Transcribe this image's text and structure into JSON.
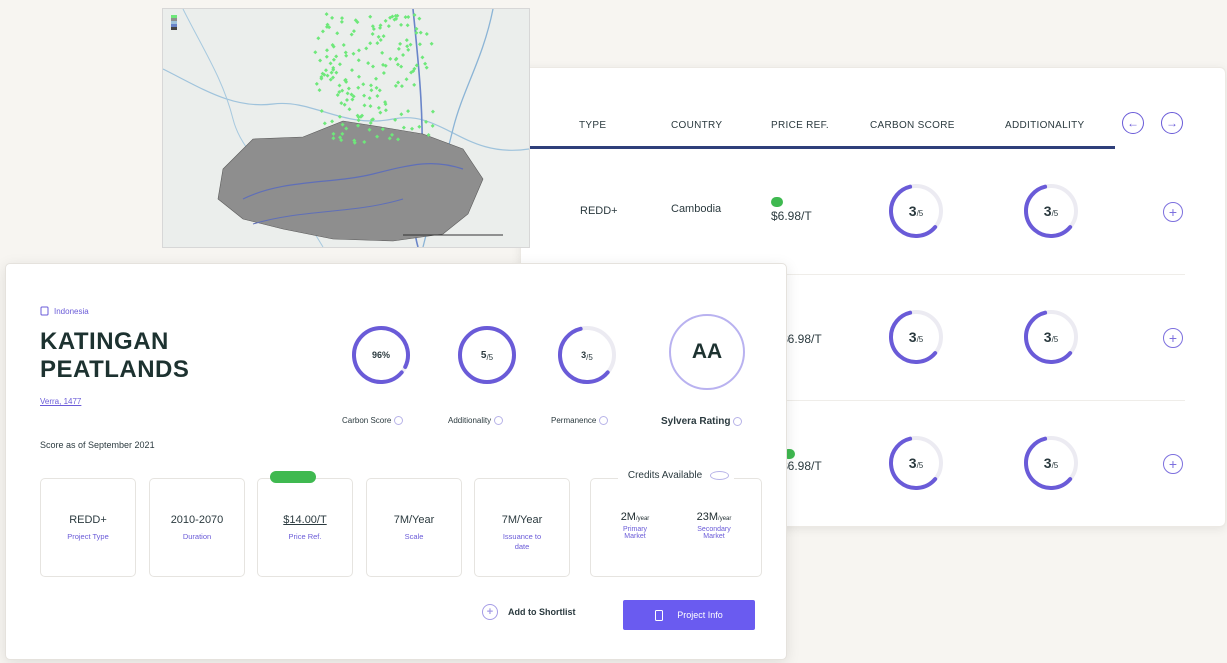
{
  "table": {
    "columns": [
      "TYPE",
      "COUNTRY",
      "PRICE REF.",
      "CARBON SCORE",
      "ADDITIONALITY"
    ],
    "nav_prev": "←",
    "nav_next": "→",
    "rows": [
      {
        "type": "REDD+",
        "country": "Cambodia",
        "price_badge": "",
        "price": "$6.98/T",
        "carbon_score": "3",
        "additionality": "3",
        "score_unit": "/5",
        "add": "+"
      },
      {
        "type": "",
        "country": "",
        "price_badge": "",
        "price": "$6.98/T",
        "carbon_score": "3",
        "additionality": "3",
        "score_unit": "/5",
        "add": "+"
      },
      {
        "type": "",
        "country": "",
        "price_badge": "",
        "price": "$6.98/T",
        "carbon_score": "3",
        "additionality": "3",
        "score_unit": "/5",
        "add": "+"
      }
    ]
  },
  "map": {
    "legend": [
      "",
      "",
      "",
      "",
      ""
    ]
  },
  "detail": {
    "country": "Indonesia",
    "title_line1": "KATINGAN",
    "title_line2": "PEATLANDS",
    "link": "Verra, 1477",
    "score_date": "Score as of September 2021",
    "metrics": {
      "carbon_score": {
        "value": "96%",
        "label": "Carbon Score",
        "fraction": 0.96
      },
      "additionality": {
        "value": "5",
        "unit": "/5",
        "label": "Additionality",
        "fraction": 1.0
      },
      "permanence": {
        "value": "3",
        "unit": "/5",
        "label": "Permanence",
        "fraction": 0.6
      },
      "rating": {
        "value": "AA",
        "label": "Sylvera Rating"
      }
    },
    "boxes": [
      {
        "value": "REDD+",
        "label": "Project Type"
      },
      {
        "value": "2010-2070",
        "label": "Duration"
      },
      {
        "value": "$14.00/T",
        "label": "Price Ref.",
        "badge": ""
      },
      {
        "value": "7M/Year",
        "label": "Scale"
      },
      {
        "value": "7M/Year",
        "label": "Issuance to date"
      }
    ],
    "credits": {
      "title": "Credits Available",
      "primary_value": "2M",
      "primary_unit": "/year",
      "primary_label": "Primary Market",
      "secondary_value": "23M",
      "secondary_unit": "/year",
      "secondary_label": "Secondary Market"
    },
    "add_shortlist": "Add to Shortlist",
    "add_icon": "+",
    "project_info": "Project Info"
  },
  "colors": {
    "accent": "#6a5bf0",
    "ring": "#6a5bd8",
    "ring_track": "#ecebf2",
    "header_line": "#2f3f7a",
    "green_badge": "#3fb950",
    "map_area": "#8e8e8e",
    "map_points": "#6ee87a"
  },
  "icons": {
    "prev": "arrow-left-icon",
    "next": "arrow-right-icon",
    "add": "plus-circle-icon",
    "info": "info-icon",
    "flag": "flag-icon",
    "doc": "document-icon"
  }
}
